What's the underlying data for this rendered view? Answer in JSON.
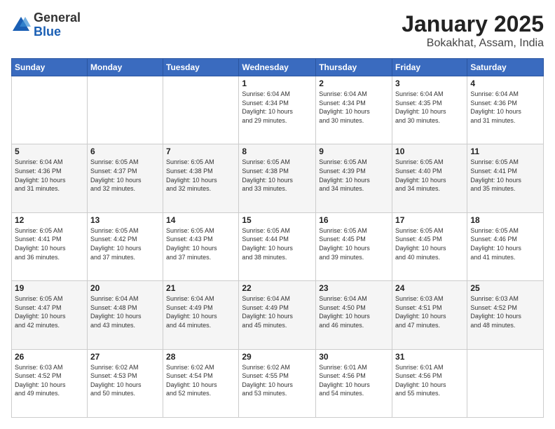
{
  "logo": {
    "general": "General",
    "blue": "Blue"
  },
  "header": {
    "month": "January 2025",
    "location": "Bokakhat, Assam, India"
  },
  "weekdays": [
    "Sunday",
    "Monday",
    "Tuesday",
    "Wednesday",
    "Thursday",
    "Friday",
    "Saturday"
  ],
  "weeks": [
    [
      {
        "day": "",
        "info": ""
      },
      {
        "day": "",
        "info": ""
      },
      {
        "day": "",
        "info": ""
      },
      {
        "day": "1",
        "info": "Sunrise: 6:04 AM\nSunset: 4:34 PM\nDaylight: 10 hours\nand 29 minutes."
      },
      {
        "day": "2",
        "info": "Sunrise: 6:04 AM\nSunset: 4:34 PM\nDaylight: 10 hours\nand 30 minutes."
      },
      {
        "day": "3",
        "info": "Sunrise: 6:04 AM\nSunset: 4:35 PM\nDaylight: 10 hours\nand 30 minutes."
      },
      {
        "day": "4",
        "info": "Sunrise: 6:04 AM\nSunset: 4:36 PM\nDaylight: 10 hours\nand 31 minutes."
      }
    ],
    [
      {
        "day": "5",
        "info": "Sunrise: 6:04 AM\nSunset: 4:36 PM\nDaylight: 10 hours\nand 31 minutes."
      },
      {
        "day": "6",
        "info": "Sunrise: 6:05 AM\nSunset: 4:37 PM\nDaylight: 10 hours\nand 32 minutes."
      },
      {
        "day": "7",
        "info": "Sunrise: 6:05 AM\nSunset: 4:38 PM\nDaylight: 10 hours\nand 32 minutes."
      },
      {
        "day": "8",
        "info": "Sunrise: 6:05 AM\nSunset: 4:38 PM\nDaylight: 10 hours\nand 33 minutes."
      },
      {
        "day": "9",
        "info": "Sunrise: 6:05 AM\nSunset: 4:39 PM\nDaylight: 10 hours\nand 34 minutes."
      },
      {
        "day": "10",
        "info": "Sunrise: 6:05 AM\nSunset: 4:40 PM\nDaylight: 10 hours\nand 34 minutes."
      },
      {
        "day": "11",
        "info": "Sunrise: 6:05 AM\nSunset: 4:41 PM\nDaylight: 10 hours\nand 35 minutes."
      }
    ],
    [
      {
        "day": "12",
        "info": "Sunrise: 6:05 AM\nSunset: 4:41 PM\nDaylight: 10 hours\nand 36 minutes."
      },
      {
        "day": "13",
        "info": "Sunrise: 6:05 AM\nSunset: 4:42 PM\nDaylight: 10 hours\nand 37 minutes."
      },
      {
        "day": "14",
        "info": "Sunrise: 6:05 AM\nSunset: 4:43 PM\nDaylight: 10 hours\nand 37 minutes."
      },
      {
        "day": "15",
        "info": "Sunrise: 6:05 AM\nSunset: 4:44 PM\nDaylight: 10 hours\nand 38 minutes."
      },
      {
        "day": "16",
        "info": "Sunrise: 6:05 AM\nSunset: 4:45 PM\nDaylight: 10 hours\nand 39 minutes."
      },
      {
        "day": "17",
        "info": "Sunrise: 6:05 AM\nSunset: 4:45 PM\nDaylight: 10 hours\nand 40 minutes."
      },
      {
        "day": "18",
        "info": "Sunrise: 6:05 AM\nSunset: 4:46 PM\nDaylight: 10 hours\nand 41 minutes."
      }
    ],
    [
      {
        "day": "19",
        "info": "Sunrise: 6:05 AM\nSunset: 4:47 PM\nDaylight: 10 hours\nand 42 minutes."
      },
      {
        "day": "20",
        "info": "Sunrise: 6:04 AM\nSunset: 4:48 PM\nDaylight: 10 hours\nand 43 minutes."
      },
      {
        "day": "21",
        "info": "Sunrise: 6:04 AM\nSunset: 4:49 PM\nDaylight: 10 hours\nand 44 minutes."
      },
      {
        "day": "22",
        "info": "Sunrise: 6:04 AM\nSunset: 4:49 PM\nDaylight: 10 hours\nand 45 minutes."
      },
      {
        "day": "23",
        "info": "Sunrise: 6:04 AM\nSunset: 4:50 PM\nDaylight: 10 hours\nand 46 minutes."
      },
      {
        "day": "24",
        "info": "Sunrise: 6:03 AM\nSunset: 4:51 PM\nDaylight: 10 hours\nand 47 minutes."
      },
      {
        "day": "25",
        "info": "Sunrise: 6:03 AM\nSunset: 4:52 PM\nDaylight: 10 hours\nand 48 minutes."
      }
    ],
    [
      {
        "day": "26",
        "info": "Sunrise: 6:03 AM\nSunset: 4:52 PM\nDaylight: 10 hours\nand 49 minutes."
      },
      {
        "day": "27",
        "info": "Sunrise: 6:02 AM\nSunset: 4:53 PM\nDaylight: 10 hours\nand 50 minutes."
      },
      {
        "day": "28",
        "info": "Sunrise: 6:02 AM\nSunset: 4:54 PM\nDaylight: 10 hours\nand 52 minutes."
      },
      {
        "day": "29",
        "info": "Sunrise: 6:02 AM\nSunset: 4:55 PM\nDaylight: 10 hours\nand 53 minutes."
      },
      {
        "day": "30",
        "info": "Sunrise: 6:01 AM\nSunset: 4:56 PM\nDaylight: 10 hours\nand 54 minutes."
      },
      {
        "day": "31",
        "info": "Sunrise: 6:01 AM\nSunset: 4:56 PM\nDaylight: 10 hours\nand 55 minutes."
      },
      {
        "day": "",
        "info": ""
      }
    ]
  ]
}
